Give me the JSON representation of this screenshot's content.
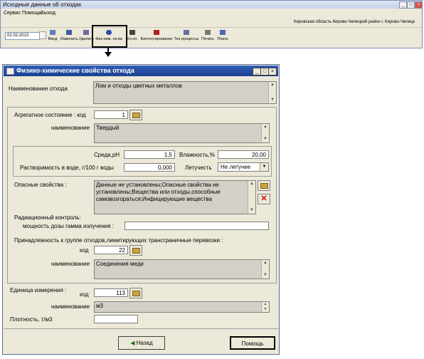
{
  "main_window": {
    "title": "Исходные данные об отходах",
    "menu": [
      "Сервис",
      "Помощь",
      "Выход"
    ],
    "region": "Кировская область  Кирово-Чепецкий район  г. Кирово-Чепецк",
    "date": "02.02.2013",
    "toolbar": [
      "Ввод",
      "Изменить",
      "Удалить",
      "Физ-хим. св-ва",
      "Кл.оп.",
      "Биотестирование",
      "Тех.процессы",
      "Печать",
      "Поиск"
    ]
  },
  "dialog": {
    "title": "Физико-химические свойства отхода",
    "waste_name_label": "Наименование отхода",
    "waste_name_value": "Лом и отходы цветных металлов",
    "state_code_label": "Агрегатное состояние : код",
    "state_code_value": "1",
    "state_name_label": "наименование",
    "state_name_value": "Твердый",
    "ph_label": "Среда,pH",
    "ph_value": "1,5",
    "humidity_label": "Влажность,%",
    "humidity_value": "20,00",
    "solubility_label": "Растворимость в воде,  г/100 г воды",
    "solubility_value": "0,000",
    "volatility_label": "Летучесть",
    "volatility_value": "Не летучее",
    "hazard_label": "Опасные свойства :",
    "hazard_value": "Данные не установлены;Опасные свойства не установлены;Вещества или отходы,способные самовозгораться;Инфицирующие вещества",
    "radiation_label": "Радиационный контроль:",
    "dose_label": "мощность дозы гамма излучения :",
    "dose_value": "",
    "transboundary_label": "Принадлежность к группе отходов,лимитирующих трансграничные перевозки :",
    "group_code_label": "код",
    "group_code_value": "22",
    "group_name_label": "наименование",
    "group_name_value": "Соединения меди",
    "unit_label": "Единица измерения :",
    "unit_code_label": "код",
    "unit_code_value": "113",
    "unit_name_label": "наименование",
    "unit_name_value": "м3",
    "density_label": "Плотность, т/м3",
    "density_value": "",
    "back_button": "Назад",
    "help_button": "Помощь"
  },
  "colors": {
    "title_bar": "#1c3f90",
    "dialog_bg": "#ece9d8",
    "readonly_bg": "#d4d0c8"
  }
}
